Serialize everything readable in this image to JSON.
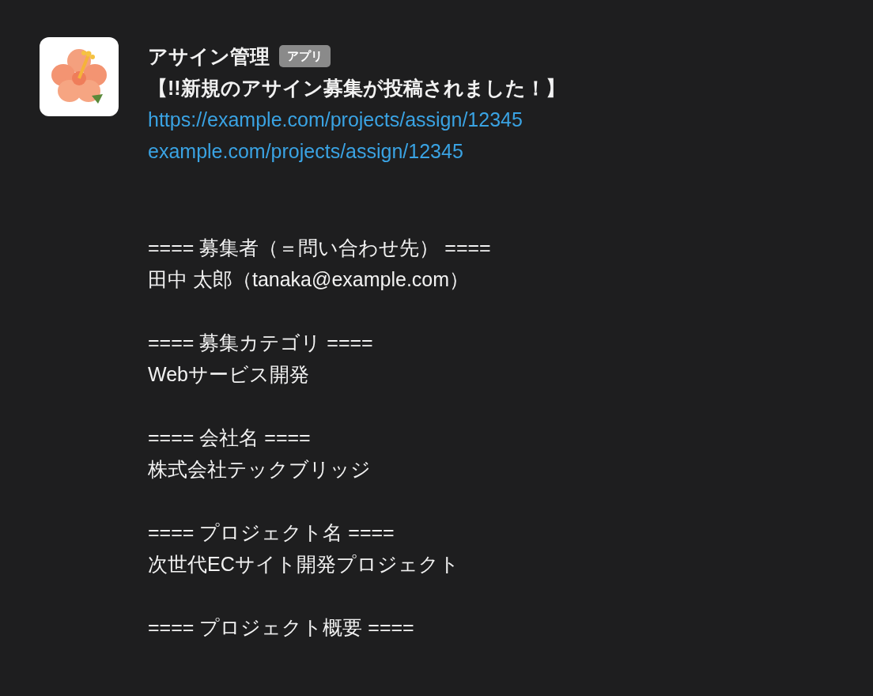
{
  "message": {
    "sender": "アサイン管理",
    "badge": "アプリ",
    "title": "【!!新規のアサイン募集が投稿されました！】",
    "links": [
      "https://example.com/projects/assign/12345",
      "example.com/projects/assign/12345"
    ],
    "sections": [
      {
        "heading": "==== 募集者（＝問い合わせ先） ====",
        "value": "田中 太郎（tanaka@example.com）"
      },
      {
        "heading": "==== 募集カテゴリ ====",
        "value": "Webサービス開発"
      },
      {
        "heading": "==== 会社名 ====",
        "value": "株式会社テックブリッジ"
      },
      {
        "heading": "==== プロジェクト名 ====",
        "value": "次世代ECサイト開発プロジェクト"
      },
      {
        "heading": "==== プロジェクト概要 ===="
      }
    ]
  }
}
